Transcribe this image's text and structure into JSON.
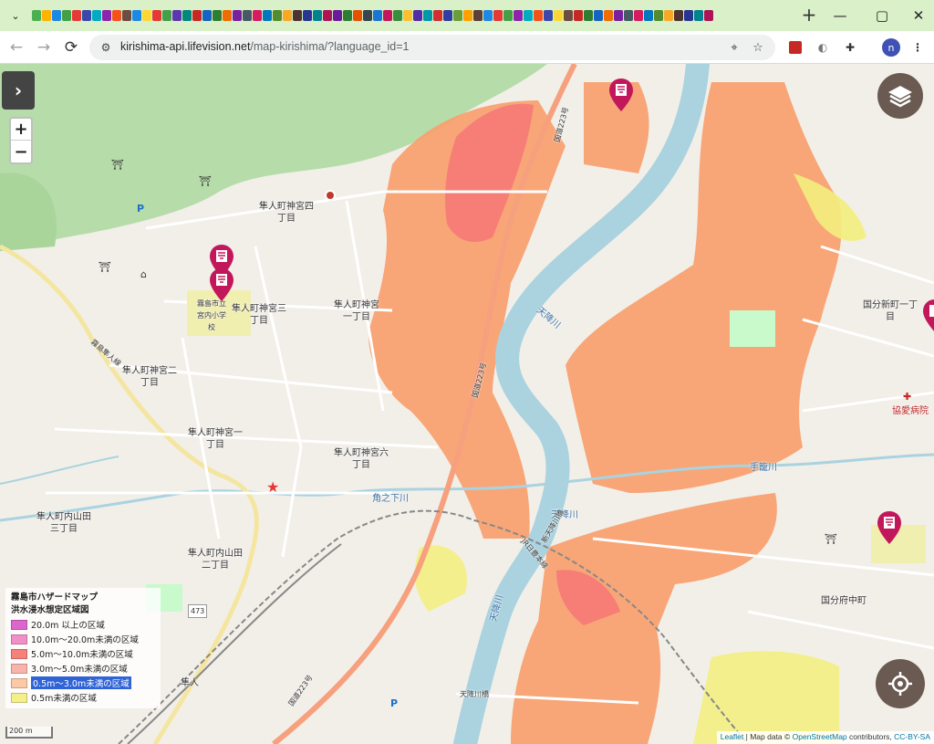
{
  "browser": {
    "url_host": "kirishima-api.lifevision.net",
    "url_path": "/map-kirishima/?language_id=1",
    "tab_favicon_colors": [
      "#4caf50",
      "#ffb300",
      "#1e88e5",
      "#43a047",
      "#e53935",
      "#3949ab",
      "#00acc1",
      "#8e24aa",
      "#f4511e",
      "#6d4c41",
      "#1e88e5",
      "#fdd835",
      "#e53935",
      "#43a047",
      "#5e35b1",
      "#00897b",
      "#c62828",
      "#1565c0",
      "#2e7d32",
      "#ef6c00",
      "#7b1fa2",
      "#455a64",
      "#d81b60",
      "#0277bd",
      "#558b2f",
      "#f9a825",
      "#4e342e",
      "#283593",
      "#00838f",
      "#ad1457",
      "#6a1b9a",
      "#2e7d32",
      "#e65100",
      "#37474f",
      "#1976d2",
      "#c2185b",
      "#388e3c",
      "#fbc02d",
      "#512da8",
      "#0097a7",
      "#d32f2f",
      "#303f9f",
      "#689f38",
      "#ffa000",
      "#5d4037",
      "#1e88e5",
      "#e53935",
      "#43a047",
      "#8e24aa",
      "#00acc1",
      "#f4511e",
      "#3949ab",
      "#fdd835",
      "#6d4c41",
      "#c62828",
      "#2e7d32",
      "#1565c0",
      "#ef6c00",
      "#7b1fa2",
      "#455a64",
      "#d81b60",
      "#0277bd",
      "#558b2f",
      "#f9a825",
      "#4e342e",
      "#283593",
      "#00838f",
      "#ad1457"
    ],
    "profile_initial": "n"
  },
  "map": {
    "district_labels": [
      {
        "id": "miyauchi4",
        "text": "隼人町神宮四\n丁目"
      },
      {
        "id": "miyauchi3",
        "text": "隼人町神宮三\n丁目"
      },
      {
        "id": "miyauchi-school",
        "text": "霧島市立\n宮内小学\n校"
      },
      {
        "id": "jingu-a",
        "text": "隼人町神宮\n一丁目"
      },
      {
        "id": "miyauchi2",
        "text": "隼人町神宮二\n丁目"
      },
      {
        "id": "miyauchi1",
        "text": "隼人町神宮一\n丁目"
      },
      {
        "id": "miyauchi6",
        "text": "隼人町神宮六\n丁目"
      },
      {
        "id": "uchiyamada3",
        "text": "隼人町内山田\n三丁目"
      },
      {
        "id": "uchiyamada2",
        "text": "隼人町内山田\n二丁目"
      },
      {
        "id": "kokubu-shinmachi",
        "text": "国分新町一丁\n目"
      },
      {
        "id": "kokubu-fuchu",
        "text": "国分府中町"
      },
      {
        "id": "kyoai-hospital",
        "text": "協愛病院"
      },
      {
        "id": "hayato",
        "text": "隼人"
      }
    ],
    "river_labels": [
      {
        "id": "amorigawa-1",
        "text": "天降川"
      },
      {
        "id": "amorigawa-2",
        "text": "天降川"
      },
      {
        "id": "amorigawa-3",
        "text": "天降川"
      },
      {
        "id": "tenagawa",
        "text": "手籠川"
      },
      {
        "id": "kakunoshita",
        "text": "角之下川"
      }
    ],
    "road_labels": [
      {
        "id": "r223a",
        "text": "国道223号"
      },
      {
        "id": "r223b",
        "text": "国道223号"
      },
      {
        "id": "r223c",
        "text": "国道223号"
      },
      {
        "id": "kirishima-hayato",
        "text": "霧島隼人線"
      },
      {
        "id": "jr-nippo",
        "text": "JR日豊本線"
      },
      {
        "id": "route473",
        "text": "473"
      },
      {
        "id": "shinsendai",
        "text": "新天降川橋"
      },
      {
        "id": "tenkobashi",
        "text": "天降川橋"
      }
    ],
    "shelter_count": 5,
    "hazard_legend": {
      "title": "霧島市ハザードマップ",
      "subtitle": "洪水浸水想定区域図",
      "items": [
        {
          "label": "20.0m 以上の区域",
          "color": "#dd66cc",
          "selected": false
        },
        {
          "label": "10.0m〜20.0m未満の区域",
          "color": "#f190c6",
          "selected": false
        },
        {
          "label": "5.0m〜10.0m未満の区域",
          "color": "#f6807a",
          "selected": false
        },
        {
          "label": "3.0m〜5.0m未満の区域",
          "color": "#f9b3ad",
          "selected": false
        },
        {
          "label": "0.5m〜3.0m未満の区域",
          "color": "#fbc9a6",
          "selected": true
        },
        {
          "label": "0.5m未満の区域",
          "color": "#f5ef8b",
          "selected": false
        }
      ]
    },
    "scale_label": "200 m",
    "attribution": {
      "leaflet": "Leaflet",
      "sep1": " | Map data © ",
      "osm": "OpenStreetMap",
      "contributors": " contributors, ",
      "license": "CC-BY-SA"
    },
    "colors": {
      "flood_orange": "#f9a06c",
      "flood_red": "#f57b76",
      "flood_yellow": "#f3ee7d",
      "forest": "#b6dcaa",
      "river": "#aad3df",
      "national_road": "#f7a07d",
      "primary_road": "#f4e6a1"
    }
  }
}
